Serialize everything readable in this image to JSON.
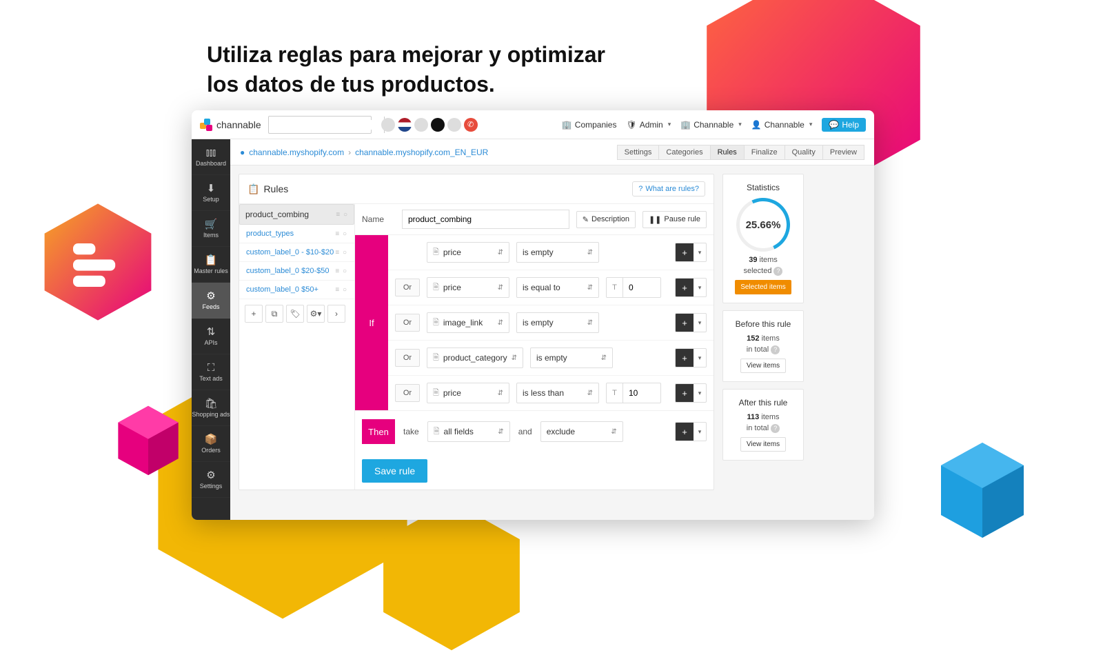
{
  "title_line1": "Utiliza reglas para mejorar y optimizar",
  "title_line2": "los datos de tus productos.",
  "brand": "channable",
  "topbar": {
    "companies": "Companies",
    "admin": "Admin",
    "channable": "Channable",
    "user": "Channable",
    "help": "Help"
  },
  "sidenav": {
    "dashboard": "Dashboard",
    "setup": "Setup",
    "items": "Items",
    "masterrules": "Master rules",
    "feeds": "Feeds",
    "apis": "APIs",
    "textads": "Text ads",
    "shoppingads": "Shopping ads",
    "orders": "Orders",
    "settings": "Settings"
  },
  "breadcrumb": {
    "a": "channable.myshopify.com",
    "b": "channable.myshopify.com_EN_EUR"
  },
  "steps": {
    "settings": "Settings",
    "categories": "Categories",
    "rules": "Rules",
    "finalize": "Finalize",
    "quality": "Quality",
    "preview": "Preview"
  },
  "rules": {
    "heading": "Rules",
    "what": "What are rules?",
    "list": {
      "r0": "product_combing",
      "r1": "product_types",
      "r2": "custom_label_0 - $10-$20",
      "r3": "custom_label_0 $20-$50",
      "r4": "custom_label_0 $50+"
    },
    "name_label": "Name",
    "name_value": "product_combing",
    "description_btn": "Description",
    "pause_btn": "Pause rule",
    "if_label": "If",
    "or_label": "Or",
    "fields": {
      "price": "price",
      "image_link": "image_link",
      "product_category": "product_category",
      "all_fields": "all fields"
    },
    "ops": {
      "is_empty": "is empty",
      "is_equal_to": "is equal to",
      "is_less_than": "is less than",
      "exclude": "exclude"
    },
    "vals": {
      "zero": "0",
      "ten": "10"
    },
    "then_label": "Then",
    "take": "take",
    "and": "and",
    "save": "Save rule"
  },
  "stats": {
    "heading": "Statistics",
    "percent": "25.66%",
    "items_count": "39",
    "items_word": "items",
    "selected": "selected",
    "selected_btn": "Selected items",
    "before_h": "Before this rule",
    "before_n": "152",
    "intotal": "in total",
    "view": "View items",
    "after_h": "After this rule",
    "after_n": "113"
  }
}
